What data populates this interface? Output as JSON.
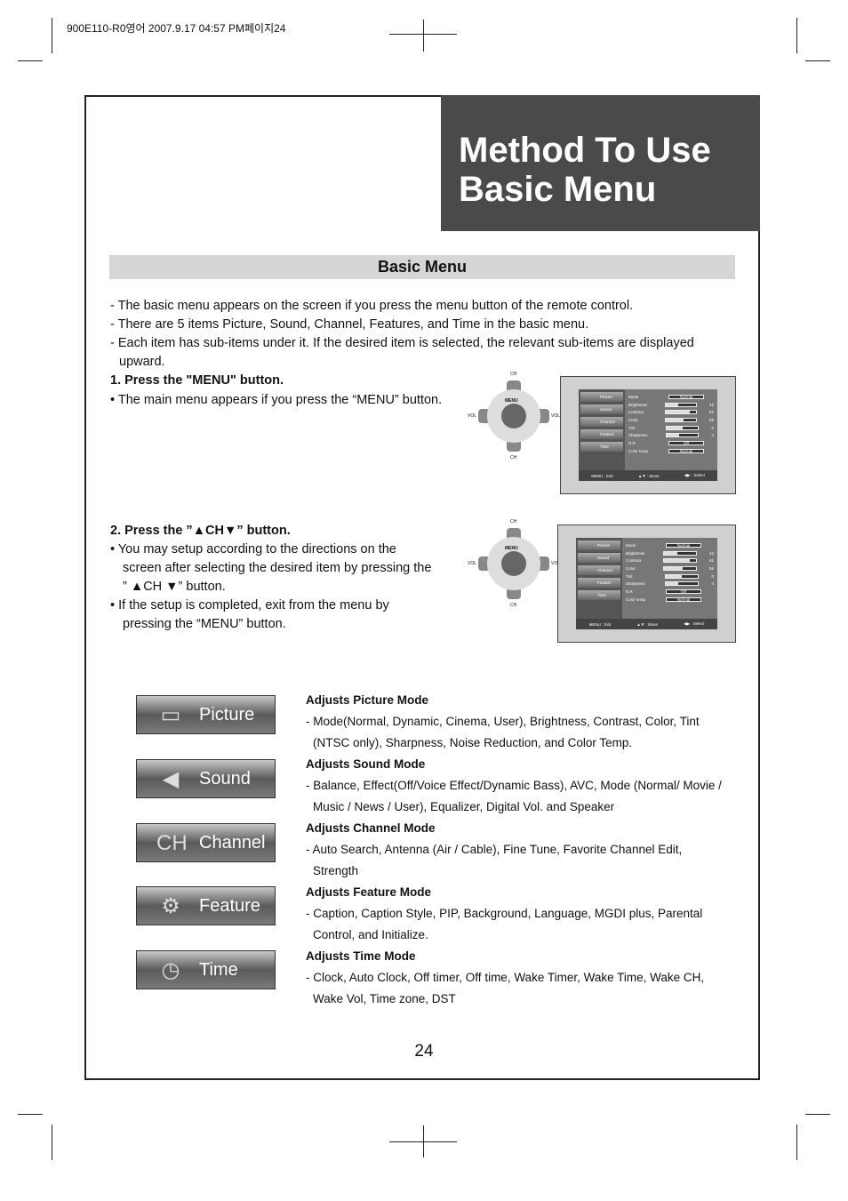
{
  "print_header": "900E110-R0영어  2007.9.17 04:57 PM페이지24",
  "title": {
    "line1": "Method To Use",
    "line2": "Basic Menu"
  },
  "section": "Basic Menu",
  "intro": [
    "- The basic menu appears on the screen if you press the menu button of the remote control.",
    "- There are 5 items Picture, Sound, Channel, Features, and Time in the basic menu.",
    "- Each item has sub-items under it. If the desired item is selected, the relevant sub-items are displayed",
    "upward."
  ],
  "step1": {
    "heading": "1. Press the \"MENU\" button.",
    "bullets": [
      "• The main menu appears if you press the “MENU” button."
    ]
  },
  "step2": {
    "heading_pre": "2. Press the ”",
    "heading_ch": "CH",
    "heading_post": "” button.",
    "bullets": [
      "• You may setup according to the directions on the",
      "screen after selecting the desired item by pressing the",
      "” ▲CH ▼” button.",
      "• If the setup is completed, exit from the menu by",
      "pressing the “MENU” button."
    ]
  },
  "remote": {
    "ch": "CH",
    "vol": "VOL",
    "menu": "MENU"
  },
  "osd": {
    "menu_items": [
      "Picture",
      "Sound",
      "Channel",
      "Feature",
      "Time"
    ],
    "rows": [
      {
        "label": "Mode",
        "box": "Normal"
      },
      {
        "label": "Brightness",
        "level": 42,
        "value": "42"
      },
      {
        "label": "Contrast",
        "level": 81,
        "value": "81"
      },
      {
        "label": "Color",
        "level": 58,
        "value": "58"
      },
      {
        "label": "Tint",
        "level": 50,
        "value": "0"
      },
      {
        "label": "Sharpness",
        "level": 40,
        "value": "4"
      },
      {
        "label": "N.R",
        "box": "Off"
      },
      {
        "label": "Color temp",
        "box": "Normal"
      }
    ],
    "footer": [
      "MENU : Exit",
      "▲▼ : Move",
      "◀▶ : Select"
    ]
  },
  "menus": [
    {
      "label": "Picture",
      "icon": "tv-icon",
      "glyph": "▭",
      "heading": "Adjusts Picture Mode",
      "text": "- Mode(Normal, Dynamic, Cinema, User), Brightness, Contrast, Color, Tint (NTSC only), Sharpness, Noise Reduction, and Color Temp."
    },
    {
      "label": "Sound",
      "icon": "speaker-icon",
      "glyph": "◀",
      "heading": "Adjusts Sound Mode",
      "text": "- Balance, Effect(Off/Voice Effect/Dynamic Bass), AVC, Mode (Normal/ Movie / Music / News / User), Equalizer, Digital Vol. and Speaker"
    },
    {
      "label": "Channel",
      "icon": "channel-icon",
      "glyph": "CH",
      "heading": "Adjusts Channel Mode",
      "text": "- Auto Search, Antenna (Air / Cable), Fine Tune, Favorite Channel Edit, Strength"
    },
    {
      "label": "Feature",
      "icon": "gear-icon",
      "glyph": "⚙",
      "heading": "Adjusts Feature Mode",
      "text": "- Caption, Caption Style, PIP, Background, Language, MGDI plus, Parental Control, and Initialize."
    },
    {
      "label": "Time",
      "icon": "clock-icon",
      "glyph": "◷",
      "heading": "Adjusts Time Mode",
      "text": "- Clock, Auto Clock, Off timer, Off time, Wake Timer, Wake Time, Wake CH, Wake Vol, Time zone, DST"
    }
  ],
  "page_number": "24"
}
